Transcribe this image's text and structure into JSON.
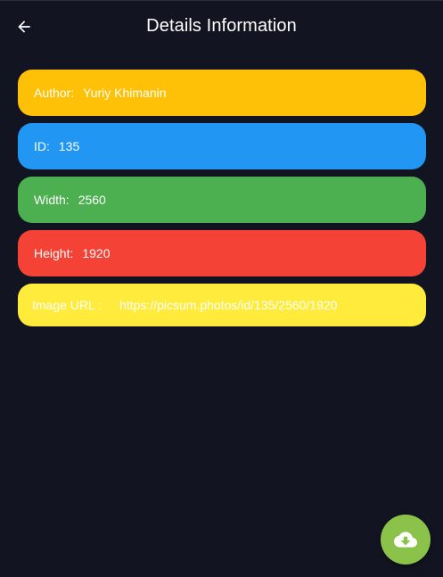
{
  "app_bar": {
    "title": "Details Information",
    "back_icon": "arrow-left-icon"
  },
  "details": {
    "author": {
      "label": "Author:",
      "value": "Yuriy Khimanin",
      "color": "#ffc107"
    },
    "id": {
      "label": "ID:",
      "value": "135",
      "color": "#2196f3"
    },
    "width": {
      "label": "Width:",
      "value": "2560",
      "color": "#4caf50"
    },
    "height": {
      "label": "Height:",
      "value": "1920",
      "color": "#f44336"
    },
    "url": {
      "label": "Image URL :",
      "value": "https://picsum.photos/id/135/2560/1920",
      "color": "#ffeb3b"
    }
  },
  "fab": {
    "icon": "cloud-download-icon",
    "color": "#8bc34a"
  }
}
